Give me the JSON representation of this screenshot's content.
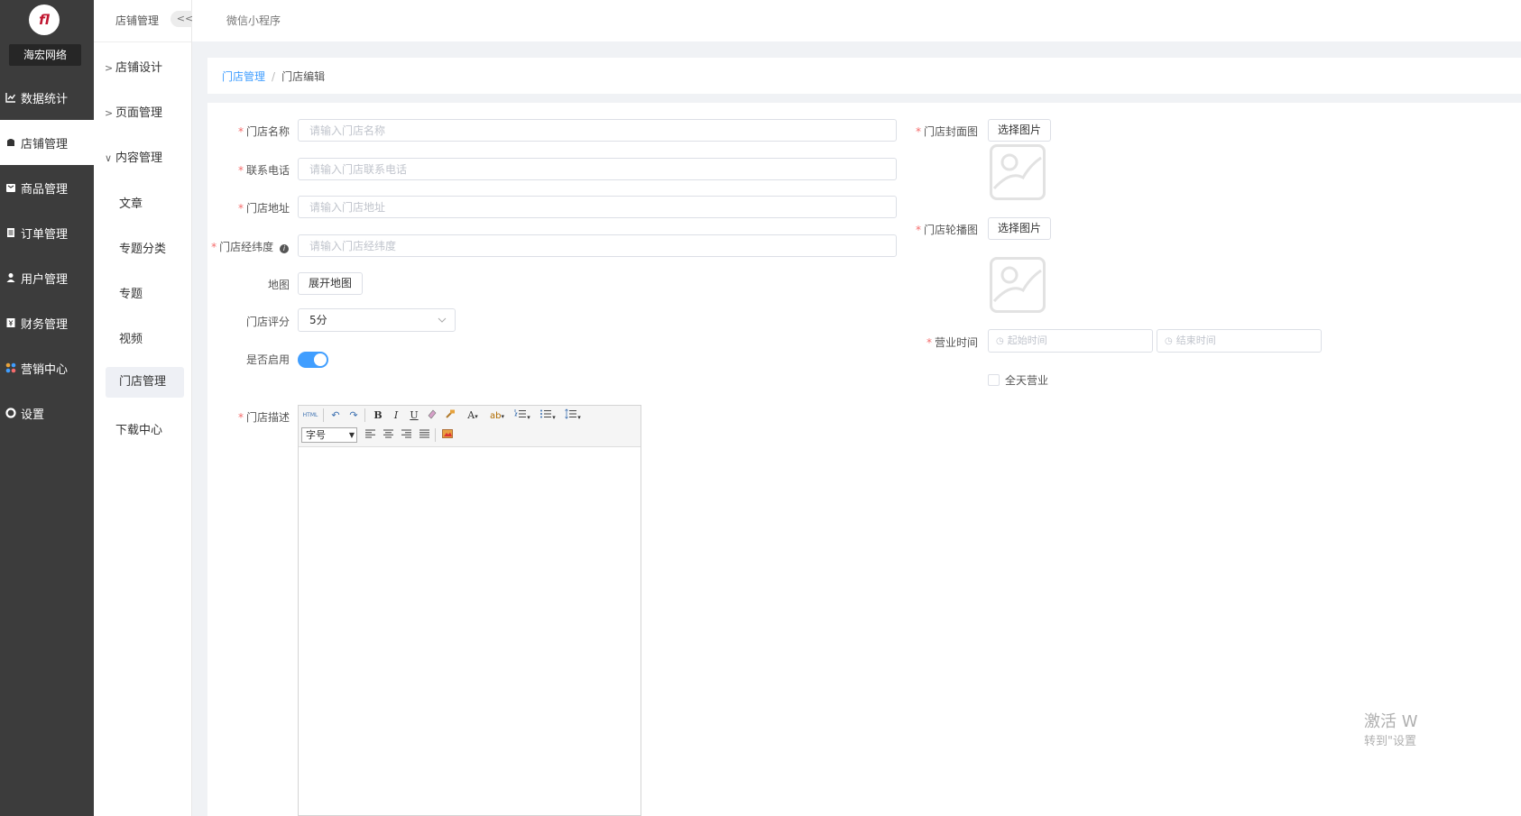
{
  "brand": {
    "name": "海宏网络",
    "logo_text": "fl"
  },
  "sidebar": {
    "items": [
      {
        "label": "数据统计",
        "icon": "chart-line-icon"
      },
      {
        "label": "店铺管理",
        "icon": "store-icon"
      },
      {
        "label": "商品管理",
        "icon": "goods-icon"
      },
      {
        "label": "订单管理",
        "icon": "order-icon"
      },
      {
        "label": "用户管理",
        "icon": "user-icon"
      },
      {
        "label": "财务管理",
        "icon": "finance-icon"
      },
      {
        "label": "营销中心",
        "icon": "marketing-icon"
      },
      {
        "label": "设置",
        "icon": "settings-icon"
      }
    ],
    "active_index": 1
  },
  "subnav": {
    "title": "店铺管理",
    "collapse_label": "<<",
    "groups": [
      {
        "label": "店铺设计",
        "arrow": ">"
      },
      {
        "label": "页面管理",
        "arrow": ">"
      },
      {
        "label": "内容管理",
        "arrow": "∨"
      }
    ],
    "children": [
      "文章",
      "专题分类",
      "专题",
      "视频",
      "门店管理"
    ],
    "download": "下载中心"
  },
  "topbar": {
    "tab": "微信小程序"
  },
  "breadcrumb": {
    "parent": "门店管理",
    "separator": "/",
    "current": "门店编辑"
  },
  "form": {
    "name": {
      "label": "门店名称",
      "placeholder": "请输入门店名称"
    },
    "phone": {
      "label": "联系电话",
      "placeholder": "请输入门店联系电话"
    },
    "address": {
      "label": "门店地址",
      "placeholder": "请输入门店地址"
    },
    "coords": {
      "label": "门店经纬度",
      "placeholder": "请输入门店经纬度"
    },
    "map": {
      "label": "地图",
      "button": "展开地图"
    },
    "rating": {
      "label": "门店评分",
      "value": "5分"
    },
    "enabled": {
      "label": "是否启用",
      "value": true
    },
    "description": {
      "label": "门店描述",
      "fontsize_label": "字号"
    },
    "cover": {
      "label": "门店封面图",
      "button": "选择图片"
    },
    "carousel": {
      "label": "门店轮播图",
      "button": "选择图片"
    },
    "hours": {
      "label": "营业时间",
      "start_placeholder": "起始时间",
      "end_placeholder": "结束时间"
    },
    "allday": {
      "label": "全天营业"
    },
    "required_mark": "*"
  },
  "editor_toolbar": {
    "html": "HTML",
    "bold": "B",
    "italic": "I",
    "underline": "U",
    "font_color": "A"
  },
  "colors": {
    "accent": "#409eff",
    "required": "#f56c6c",
    "sidebar_bg": "#3c3c3c"
  },
  "watermark": {
    "line1": "激活 W",
    "line2": "转到\"设置"
  }
}
